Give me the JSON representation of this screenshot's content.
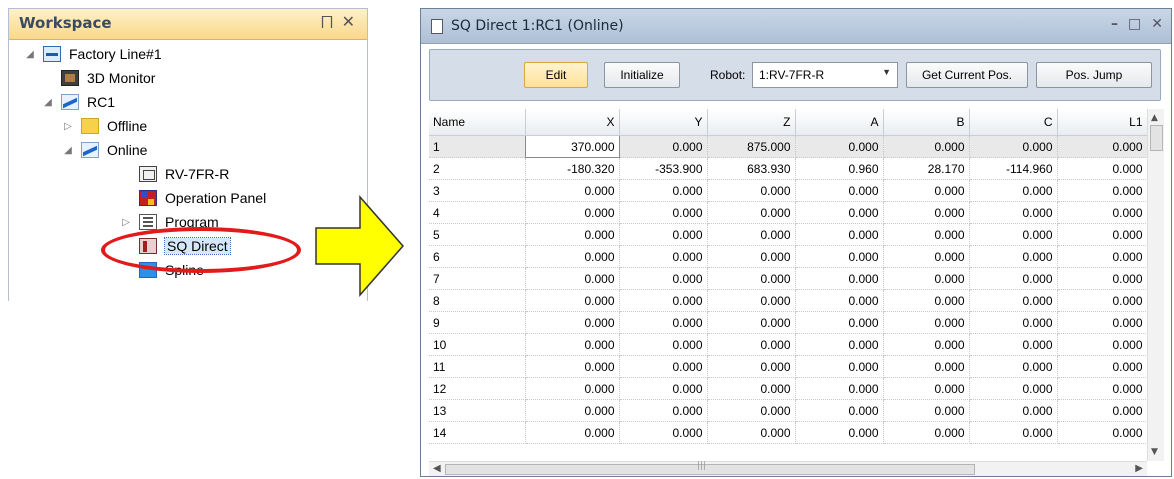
{
  "workspace": {
    "title": "Workspace",
    "pin_glyph": "⨅",
    "close_glyph": "✕",
    "tree": [
      {
        "label": "Factory Line#1",
        "toggle": "◢",
        "icon": "factory-line-icon"
      },
      {
        "label": "3D Monitor",
        "toggle": "",
        "icon": "3d-monitor-icon"
      },
      {
        "label": "RC1",
        "toggle": "◢",
        "icon": "robot-controller-icon"
      },
      {
        "label": "Offline",
        "toggle": "▷",
        "icon": "offline-icon"
      },
      {
        "label": "Online",
        "toggle": "◢",
        "icon": "online-icon"
      },
      {
        "label": "RV-7FR-R",
        "toggle": "",
        "icon": "robot-icon"
      },
      {
        "label": "Operation Panel",
        "toggle": "",
        "icon": "operation-panel-icon"
      },
      {
        "label": "Program",
        "toggle": "▷",
        "icon": "program-icon"
      },
      {
        "label": "SQ Direct",
        "toggle": "",
        "icon": "sq-direct-icon"
      },
      {
        "label": "Spline",
        "toggle": "",
        "icon": "spline-icon"
      }
    ]
  },
  "window": {
    "title": "SQ Direct 1:RC1 (Online)",
    "controls": [
      "–",
      "□",
      "✕"
    ],
    "toolbar": {
      "edit_label": "Edit",
      "initialize_label": "Initialize",
      "robot_label": "Robot:",
      "robot_value": "1:RV-7FR-R",
      "get_current_pos_label": "Get Current Pos.",
      "pos_jump_label": "Pos. Jump"
    },
    "grid": {
      "columns": [
        "Name",
        "X",
        "Y",
        "Z",
        "A",
        "B",
        "C",
        "L1"
      ],
      "rows": [
        [
          "1",
          "370.000",
          "0.000",
          "875.000",
          "0.000",
          "0.000",
          "0.000",
          "0.000"
        ],
        [
          "2",
          "-180.320",
          "-353.900",
          "683.930",
          "0.960",
          "28.170",
          "-114.960",
          "0.000"
        ],
        [
          "3",
          "0.000",
          "0.000",
          "0.000",
          "0.000",
          "0.000",
          "0.000",
          "0.000"
        ],
        [
          "4",
          "0.000",
          "0.000",
          "0.000",
          "0.000",
          "0.000",
          "0.000",
          "0.000"
        ],
        [
          "5",
          "0.000",
          "0.000",
          "0.000",
          "0.000",
          "0.000",
          "0.000",
          "0.000"
        ],
        [
          "6",
          "0.000",
          "0.000",
          "0.000",
          "0.000",
          "0.000",
          "0.000",
          "0.000"
        ],
        [
          "7",
          "0.000",
          "0.000",
          "0.000",
          "0.000",
          "0.000",
          "0.000",
          "0.000"
        ],
        [
          "8",
          "0.000",
          "0.000",
          "0.000",
          "0.000",
          "0.000",
          "0.000",
          "0.000"
        ],
        [
          "9",
          "0.000",
          "0.000",
          "0.000",
          "0.000",
          "0.000",
          "0.000",
          "0.000"
        ],
        [
          "10",
          "0.000",
          "0.000",
          "0.000",
          "0.000",
          "0.000",
          "0.000",
          "0.000"
        ],
        [
          "11",
          "0.000",
          "0.000",
          "0.000",
          "0.000",
          "0.000",
          "0.000",
          "0.000"
        ],
        [
          "12",
          "0.000",
          "0.000",
          "0.000",
          "0.000",
          "0.000",
          "0.000",
          "0.000"
        ],
        [
          "13",
          "0.000",
          "0.000",
          "0.000",
          "0.000",
          "0.000",
          "0.000",
          "0.000"
        ],
        [
          "14",
          "0.000",
          "0.000",
          "0.000",
          "0.000",
          "0.000",
          "0.000",
          "0.000"
        ]
      ]
    }
  },
  "colors": {
    "highlight_oval": "#e21a1a",
    "arrow_fill": "#ffff00",
    "edit_button": "#ffe19a"
  }
}
